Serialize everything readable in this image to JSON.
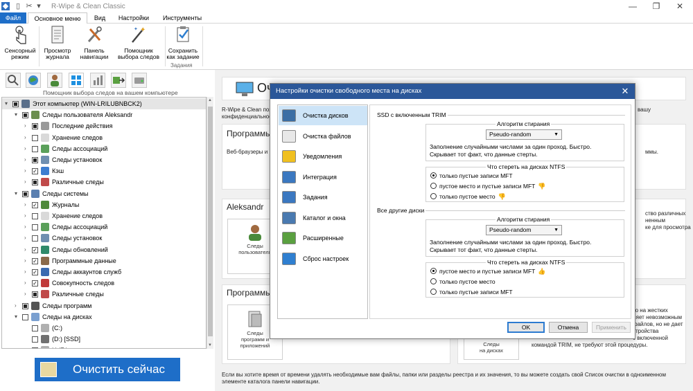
{
  "window": {
    "title": "R-Wipe & Clean Classic"
  },
  "menu": {
    "tabs": [
      "Файл",
      "Основное меню",
      "Вид",
      "Настройки",
      "Инструменты"
    ]
  },
  "ribbon": {
    "buttons": [
      {
        "label1": "Сенсорный",
        "label2": "режим",
        "icon": "touch-hand-icon"
      },
      {
        "label1": "Просмотр",
        "label2": "журнала",
        "icon": "log-book-icon"
      },
      {
        "label1": "Панель",
        "label2": "навигации",
        "icon": "tools-icon"
      },
      {
        "label1": "Помощник",
        "label2": "выбора следов",
        "icon": "wand-icon"
      },
      {
        "label1": "Сохранить",
        "label2": "как задание",
        "icon": "save-task-icon"
      }
    ],
    "group_label": "Задания"
  },
  "left_toolbar": {
    "caption": "Помощник выбора следов на вашем компьютере"
  },
  "tree": {
    "items": [
      {
        "label": "Этот компьютер  (WIN-LRILUBNBCK2)",
        "level": 0,
        "expander": "▾",
        "check": "partial",
        "icon": "#5a6f8a"
      },
      {
        "label": "Следы пользователя Aleksandr",
        "level": 1,
        "expander": "▾",
        "check": "partial",
        "icon": "#6b8e4e"
      },
      {
        "label": "Последние действия",
        "level": 2,
        "expander": "›",
        "check": "partial",
        "icon": "#9a9a9a"
      },
      {
        "label": "Хранение следов",
        "level": 2,
        "expander": "›",
        "check": "none",
        "icon": "#d9d9d9"
      },
      {
        "label": "Следы ассоциаций",
        "level": 2,
        "expander": "›",
        "check": "none",
        "icon": "#5aa05a"
      },
      {
        "label": "Следы установок",
        "level": 2,
        "expander": "›",
        "check": "partial",
        "icon": "#6f8fb0"
      },
      {
        "label": "Кэш",
        "level": 2,
        "expander": "›",
        "check": "checked",
        "icon": "#3c7dd0"
      },
      {
        "label": "Различные следы",
        "level": 2,
        "expander": "›",
        "check": "partial",
        "icon": "#c04a4a"
      },
      {
        "label": "Следы системы",
        "level": 1,
        "expander": "▾",
        "check": "partial",
        "icon": "#5a7fb0"
      },
      {
        "label": "Журналы",
        "level": 2,
        "expander": "›",
        "check": "checked",
        "icon": "#4f8a3a"
      },
      {
        "label": "Хранение следов",
        "level": 2,
        "expander": "›",
        "check": "none",
        "icon": "#d9d9d9"
      },
      {
        "label": "Следы ассоциаций",
        "level": 2,
        "expander": "›",
        "check": "none",
        "icon": "#5aa05a"
      },
      {
        "label": "Следы установок",
        "level": 2,
        "expander": "›",
        "check": "none",
        "icon": "#6f8fb0"
      },
      {
        "label": "Следы обновлений",
        "level": 2,
        "expander": "›",
        "check": "checked",
        "icon": "#2f8a6a"
      },
      {
        "label": "Программные данные",
        "level": 2,
        "expander": "›",
        "check": "checked",
        "icon": "#8a6a4a"
      },
      {
        "label": "Следы аккаунтов служб",
        "level": 2,
        "expander": "›",
        "check": "checked",
        "icon": "#3a6ab0"
      },
      {
        "label": "Совокупность следов",
        "level": 2,
        "expander": "›",
        "check": "checked",
        "icon": "#c03a3a"
      },
      {
        "label": "Различные следы",
        "level": 2,
        "expander": "›",
        "check": "partial",
        "icon": "#c04a4a"
      },
      {
        "label": "Следы программ",
        "level": 1,
        "expander": "›",
        "check": "partial",
        "icon": "#555555"
      },
      {
        "label": "Следы на дисках",
        "level": 1,
        "expander": "▾",
        "check": "none",
        "icon": "#7aa0d0"
      },
      {
        "label": "(C:)",
        "level": 2,
        "expander": "",
        "check": "none",
        "icon": "#b0b0b0"
      },
      {
        "label": "(D:) [SSD]",
        "level": 2,
        "expander": "",
        "check": "none",
        "icon": "#707070"
      },
      {
        "label": "Н                (F:)",
        "level": 2,
        "expander": "",
        "check": "none",
        "icon": "#b0b0b0"
      }
    ]
  },
  "clean_button": {
    "label": "Очистить сейчас"
  },
  "background": {
    "header_partial": "Оч",
    "intro1": "R-Wipe & Clean поз",
    "intro2": "конфиденциальност",
    "intro_right": "вашу",
    "section_programs": "Программы",
    "web_text": "Веб-браузеры и мн",
    "web_right": "ммы.",
    "section_user": "Aleksandr",
    "section_programs2": "Программы",
    "user_tile1": "Следы",
    "user_tile2": "пользователя",
    "prog_tile1": "Следы",
    "prog_tile2": "программ и приложений",
    "disk_tile1": "Следы",
    "disk_tile2": "на дисках",
    "right_lines1": [
      "ство различных",
      "ненным",
      "ке для просмотра"
    ],
    "right_lines2": [
      "то на жестких",
      "ляет невозможным",
      "файлов, но не дает",
      "стройства",
      "с включенной"
    ],
    "trim_line": "командой TRIM, не требуют этой процедуры.",
    "footer": "Если вы хотите время от времени удалять необходимые вам файлы, папки или разделы реестра и их значения, то вы можете создать свой Список очистки в одноименном элементе каталога  панели навигации."
  },
  "dialog": {
    "title": "Настройки очистки свободного места на дисках",
    "nav": [
      {
        "label": "Очистка дисков",
        "icon": "disk-icon",
        "color": "#3a6ea5"
      },
      {
        "label": "Очистка файлов",
        "icon": "file-icon",
        "color": "#e8e8e8"
      },
      {
        "label": "Уведомления",
        "icon": "warning-icon",
        "color": "#f0c020"
      },
      {
        "label": "Интеграция",
        "icon": "integration-icon",
        "color": "#3b78c0"
      },
      {
        "label": "Задания",
        "icon": "task-icon",
        "color": "#3b78c0"
      },
      {
        "label": "Каталог и окна",
        "icon": "catalog-icon",
        "color": "#4a7ab0"
      },
      {
        "label": "Расширенные",
        "icon": "advanced-icon",
        "color": "#5aa040"
      },
      {
        "label": "Сброс настроек",
        "icon": "reset-icon",
        "color": "#2f7fd0"
      }
    ],
    "ssd": {
      "section_title": "SSD с включенным TRIM",
      "algo_title": "Алгоритм стирания",
      "algo_value": "Pseudo-random",
      "desc": "Заполнение случайными числами за один проход. Быстро. Скрывает тот факт, что данные стерты.",
      "ntfs_title": "Что стереть на дисках NTFS",
      "options": [
        "только пустые записи MFT",
        "пустое место и пустые записи MFT",
        "только пустое место"
      ]
    },
    "other": {
      "section_title": "Все другие диски",
      "algo_title": "Алгоритм стирания",
      "algo_value": "Pseudo-random",
      "desc": "Заполнение случайными числами за один проход. Быстро. Скрывает тот факт, что данные стерты.",
      "ntfs_title": "Что стереть на дисках NTFS",
      "options": [
        "пустое место и пустые записи MFT",
        "только пустое место",
        "только пустые записи MFT"
      ]
    },
    "buttons": {
      "ok": "OK",
      "cancel": "Отмена",
      "apply": "Применить"
    }
  }
}
